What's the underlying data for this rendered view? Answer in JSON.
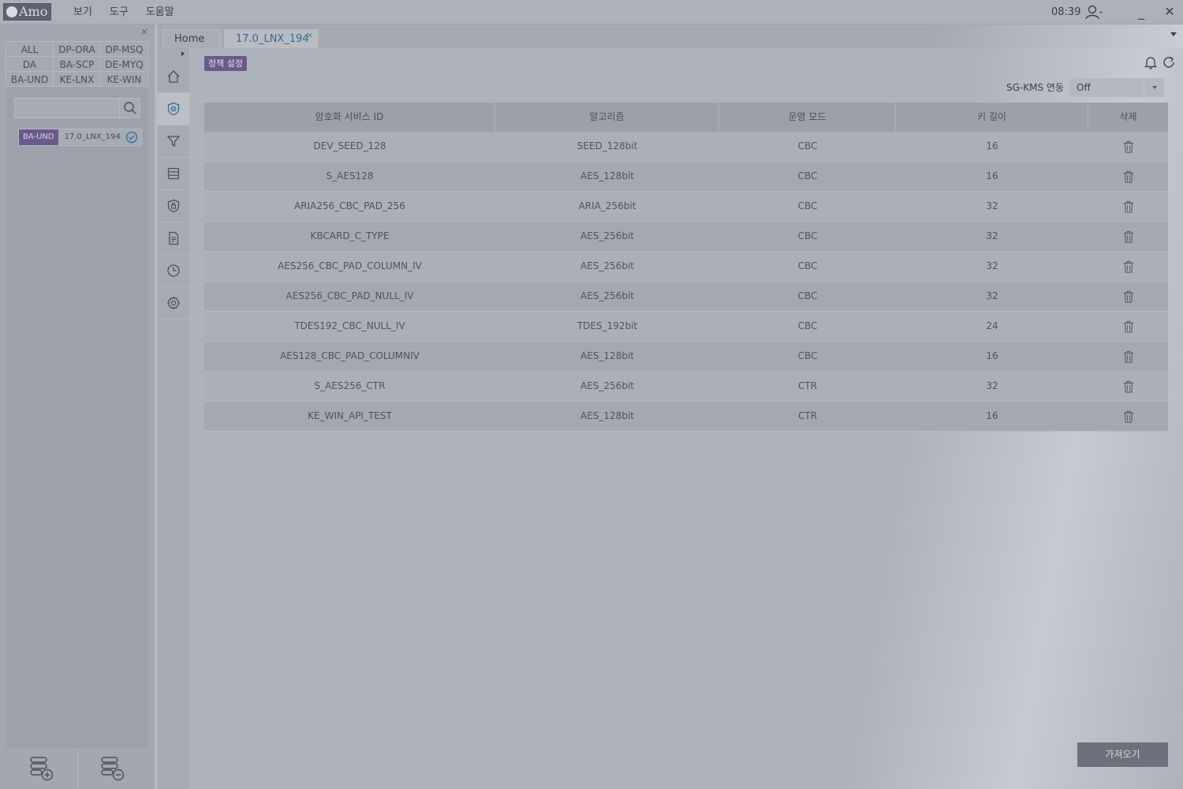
{
  "app": {
    "logo_text": "Amo",
    "menu": [
      "보기",
      "도구",
      "도움말"
    ],
    "clock": "08:39"
  },
  "left_panel": {
    "close_glyph": "×",
    "categories": [
      "ALL",
      "DP-ORA",
      "DP-MSQ",
      "DA",
      "BA-SCP",
      "DE-MYQ",
      "BA-UND",
      "KE-LNX",
      "KE-WIN"
    ],
    "search": {
      "value": "",
      "placeholder": ""
    },
    "server": {
      "tag": "BA-UND",
      "name": "17.0_LNX_194"
    }
  },
  "tabs": [
    {
      "label": "Home"
    },
    {
      "label": "17.0_LNX_194",
      "close_glyph": "×"
    }
  ],
  "main": {
    "badge": "정책 설정",
    "kms": {
      "label": "SG-KMS 연동",
      "value": "Off"
    },
    "columns": [
      "암호화 서비스 ID",
      "알고리즘",
      "운영 모드",
      "키 길이",
      "삭제"
    ],
    "rows": [
      {
        "id": "DEV_SEED_128",
        "algo": "SEED_128bit",
        "mode": "CBC",
        "keylen": "16"
      },
      {
        "id": "S_AES128",
        "algo": "AES_128bit",
        "mode": "CBC",
        "keylen": "16"
      },
      {
        "id": "ARIA256_CBC_PAD_256",
        "algo": "ARIA_256bit",
        "mode": "CBC",
        "keylen": "32"
      },
      {
        "id": "KBCARD_C_TYPE",
        "algo": "AES_256bit",
        "mode": "CBC",
        "keylen": "32"
      },
      {
        "id": "AES256_CBC_PAD_COLUMN_IV",
        "algo": "AES_256bit",
        "mode": "CBC",
        "keylen": "32"
      },
      {
        "id": "AES256_CBC_PAD_NULL_IV",
        "algo": "AES_256bit",
        "mode": "CBC",
        "keylen": "32"
      },
      {
        "id": "TDES192_CBC_NULL_IV",
        "algo": "TDES_192bit",
        "mode": "CBC",
        "keylen": "24"
      },
      {
        "id": "AES128_CBC_PAD_COLUMNIV",
        "algo": "AES_128bit",
        "mode": "CBC",
        "keylen": "16"
      },
      {
        "id": "S_AES256_CTR",
        "algo": "AES_256bit",
        "mode": "CTR",
        "keylen": "32"
      },
      {
        "id": "KE_WIN_API_TEST",
        "algo": "AES_128bit",
        "mode": "CTR",
        "keylen": "16"
      }
    ],
    "import_button": "가져오기"
  },
  "icons": {
    "rail": [
      "home-icon",
      "shield-policy-icon",
      "filter-icon",
      "database-icon",
      "security-icon",
      "document-icon",
      "clock-icon",
      "gear-icon"
    ],
    "accent_color": "#2f6f96",
    "badge_color": "#6a5a8a"
  }
}
